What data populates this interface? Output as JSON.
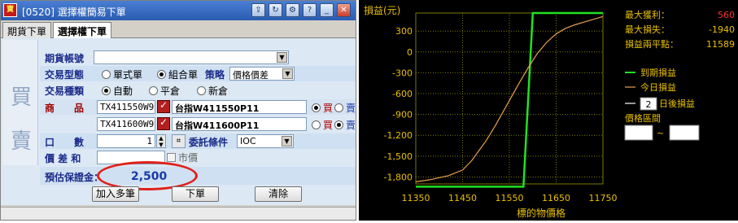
{
  "window": {
    "title": "[0520] 選擇權簡易下單",
    "logo_text": "寶",
    "tabs": [
      {
        "label": "期貨下單",
        "active": false
      },
      {
        "label": "選擇權下單",
        "active": true
      }
    ],
    "side_chars": [
      "買",
      "賣"
    ],
    "form": {
      "account_label": "期貨帳號",
      "account_value": "",
      "order_type_label": "交易型態",
      "order_type_options": [
        "單式單",
        "組合單"
      ],
      "order_type_selected": "組合單",
      "strategy_label": "策略",
      "strategy_value": "價格價差",
      "trade_kind_label": "交易種類",
      "trade_kind_options": [
        "自動",
        "平倉",
        "新倉"
      ],
      "trade_kind_selected": "自動",
      "product_label": "商　　品",
      "legs": [
        {
          "code": "TX411550W9",
          "name": "台指W411550P11",
          "side_buy": "買",
          "side_sell": "賣",
          "selected": "買"
        },
        {
          "code": "TX411600W9",
          "name": "台指W411600P11",
          "side_buy": "買",
          "side_sell": "賣",
          "selected": "賣"
        }
      ],
      "qty_label": "口　　數",
      "qty_value": "1",
      "condition_label": "委託條件",
      "condition_value": "IOC",
      "price_diff_label": "價 差 和",
      "price_diff_value": "",
      "market_price_label": "市價",
      "margin_label": "預估保證金：",
      "margin_value": "2,500"
    },
    "buttons": {
      "add_multi": "加入多筆",
      "place_order": "下單",
      "clear": "清除"
    }
  },
  "chart_data": {
    "type": "line",
    "title": "損益(元)",
    "xlabel": "標的物價格",
    "ylabel": "損益(元)",
    "xlim": [
      11350,
      11750
    ],
    "ylim": [
      -1900,
      560
    ],
    "x_ticks": [
      11350,
      11450,
      11550,
      11650,
      11750
    ],
    "y_ticks": [
      300,
      0,
      -300,
      -600,
      -900,
      -1200,
      -1500,
      -1800
    ],
    "y_tick_labels": [
      "300",
      "0",
      "-300",
      "-600",
      "-900",
      "-1,200",
      "-1,500",
      "-1,800"
    ],
    "colors": {
      "expiry": "#22e022",
      "today": "#e8a050",
      "axis_text": "#e8c000",
      "grid": "#7a7a00"
    },
    "series": [
      {
        "name": "到期損益",
        "x": [
          11350,
          11580,
          11600,
          11750
        ],
        "y": [
          -1940,
          -1940,
          560,
          560
        ]
      },
      {
        "name": "今日損益",
        "x": [
          11350,
          11380,
          11400,
          11420,
          11450,
          11470,
          11500,
          11520,
          11550,
          11570,
          11590,
          11610,
          11630,
          11650,
          11670,
          11690,
          11710,
          11730,
          11750
        ],
        "y": [
          -1870,
          -1840,
          -1810,
          -1780,
          -1700,
          -1560,
          -1280,
          -1060,
          -700,
          -460,
          -230,
          -20,
          140,
          260,
          340,
          390,
          430,
          470,
          510
        ]
      }
    ],
    "legend": {
      "expiry": "到期損益",
      "today": "今日損益"
    },
    "stats": {
      "max_profit_label": "最大獲利：",
      "max_profit": "560",
      "max_loss_label": "最大損失：",
      "max_loss": "-1940",
      "breakeven_label": "損益兩平點：",
      "breakeven": "11589"
    },
    "days_after_value": "2",
    "days_after_label": "日後損益",
    "price_range_label": "價格區間",
    "range_sep": "~"
  }
}
